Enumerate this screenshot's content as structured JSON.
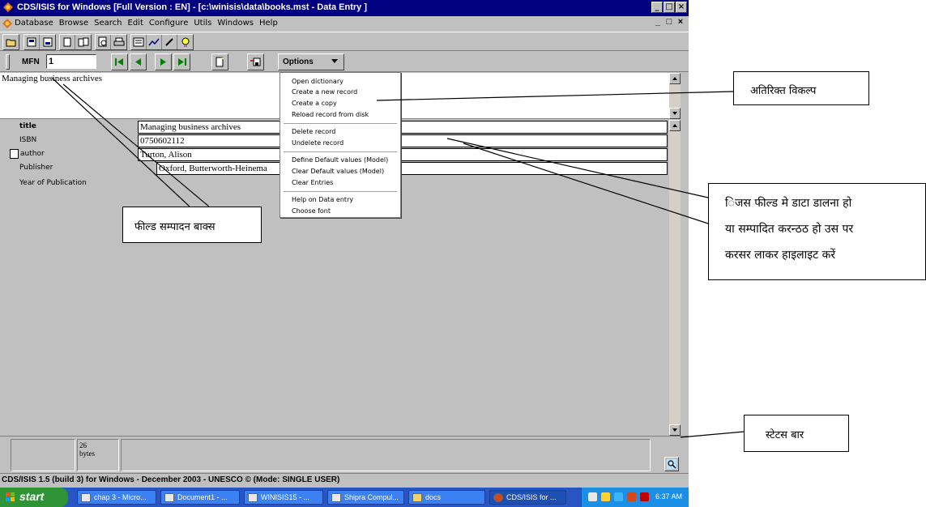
{
  "window": {
    "title": "CDS/ISIS for Windows [Full Version : EN] - [c:\\winisis\\data\\books.mst - Data Entry ]",
    "min": "_",
    "max": "□",
    "close": "×"
  },
  "menubar": {
    "items": [
      "Database",
      "Browse",
      "Search",
      "Edit",
      "Configure",
      "Utils",
      "Windows",
      "Help"
    ],
    "min": "_",
    "max": "□",
    "close": "×"
  },
  "toolbar": {
    "icons": [
      "open-folder-icon",
      "print-icon",
      "print-setup-icon",
      "copy-icon",
      "paste-icon",
      "preview-icon",
      "printer-icon",
      "form-icon",
      "chart-icon",
      "pencil-icon",
      "bulb-icon"
    ]
  },
  "record_nav": {
    "mfn_label": "MFN",
    "mfn_value": "1",
    "options_label": "Options"
  },
  "edit_area": {
    "text": "Managing business archives"
  },
  "fields": [
    {
      "label": "title",
      "value": "Managing business archives"
    },
    {
      "label": "ISBN",
      "value": "0750602112"
    },
    {
      "label": "author",
      "value": "Turton, Alison"
    },
    {
      "label": "Publisher",
      "value": "Oxford, Butterworth-Heinema"
    },
    {
      "label": "Year of Publication",
      "value": ""
    }
  ],
  "options_menu": {
    "groups": [
      [
        "Open dictionary",
        "Create a new record",
        "Create a copy",
        "Reload record from disk"
      ],
      [
        "Delete record",
        "Undelete record"
      ],
      [
        "Define Default values (Model)",
        "Clear Default values (Model)",
        "Clear Entries"
      ],
      [
        "Help on Data entry",
        "Choose font"
      ]
    ]
  },
  "status": {
    "size_value": "26",
    "size_unit": "bytes",
    "footer": "CDS/ISIS 1.5 (build 3) for Windows - December 2003 - UNESCO © (Mode: SINGLE USER)"
  },
  "taskbar": {
    "start": "start",
    "tasks": [
      {
        "label": "chap 3 - Micro..."
      },
      {
        "label": "Document1 - ..."
      },
      {
        "label": "WINISIS15 - ..."
      },
      {
        "label": "Shipra Compul..."
      },
      {
        "label": "docs"
      },
      {
        "label": "CDS/ISIS for ..."
      }
    ],
    "clock": "6:37 AM"
  },
  "annotations": {
    "extra_options": "अतिरिक्त विकल्प",
    "field_instruction": [
      "िजस फील्ड मे डाटा डालना हो",
      "या सम्पादित करन्ठठ हो उस पर",
      "करसर लाकर हाइलाइट करें"
    ],
    "status_bar": "स्टेटस बार",
    "field_edit_box": "फील्ड सम्पादन बाक्स"
  }
}
